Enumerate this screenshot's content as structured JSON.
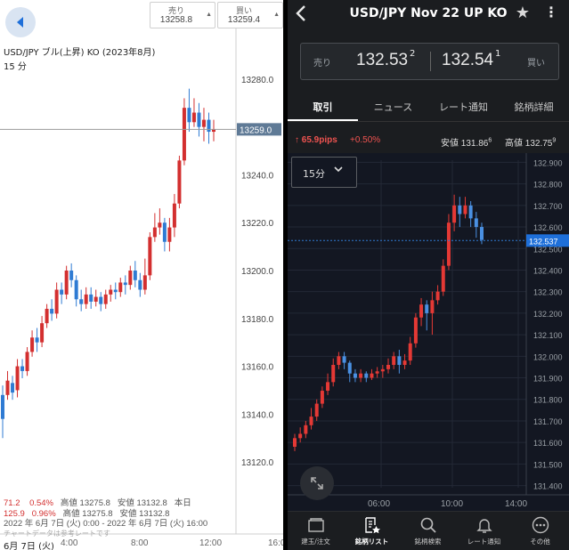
{
  "left": {
    "sell_quote": {
      "label": "売り",
      "value": "13258.8",
      "arrow": "▲"
    },
    "buy_quote": {
      "label": "買い",
      "value": "13259.4",
      "arrow": "▲"
    },
    "title": "USD/JPY ブル(上昇) KO (2023年8月)",
    "period": "15 分",
    "current_price": "13259.0",
    "stats": {
      "line1": {
        "change": "71.2",
        "pct": "0.54%",
        "high": "高値 13275.8",
        "low": "安値 13132.8",
        "note": "本日"
      },
      "line2": {
        "change": "125.9",
        "pct": "0.96%",
        "high": "高値 13275.8",
        "low": "安値 13132.8"
      },
      "range": "2022 年 6月 7日 (火) 0:00 - 2022 年 6月 7日 (火) 16:00"
    },
    "note": "チャートデータは参考レートです",
    "x_date_label": "6月 7日 (火)",
    "x_ticks": [
      "4:00",
      "8:00",
      "12:00",
      "16:0"
    ]
  },
  "right": {
    "title": "USD/JPY Nov 22 UP KO",
    "back_icon": "chevron-left-icon",
    "star_icon": "star-icon",
    "menu_icon": "more-vert-icon",
    "quote": {
      "sell_label": "売り",
      "sell_value": "132.53",
      "sell_sup": "2",
      "buy_value": "132.54",
      "buy_sup": "1",
      "buy_label": "買い"
    },
    "tabs": [
      "取引",
      "ニュース",
      "レート通知",
      "銘柄詳細"
    ],
    "stats": {
      "pips": "↑ 65.9pips",
      "pct": "+0.50%",
      "low_label": "安値",
      "low_value": "131.86",
      "low_sup": "6",
      "high_label": "高値",
      "high_value": "132.75",
      "high_sup": "9"
    },
    "period": "15分",
    "current_price": "132.537",
    "x_ticks": [
      "06:00",
      "10:00",
      "14:00"
    ],
    "nav": [
      {
        "label": "建玉/注文",
        "icon": "positions-icon"
      },
      {
        "label": "銘柄リスト",
        "icon": "watchlist-icon"
      },
      {
        "label": "銘柄検索",
        "icon": "search-icon"
      },
      {
        "label": "レート通知",
        "icon": "bell-icon"
      },
      {
        "label": "その他",
        "icon": "more-icon"
      }
    ],
    "active_nav": "銘柄リスト"
  },
  "colors": {
    "up": "#d32f2f",
    "down": "#2f7bd3",
    "right_up": "#e53935",
    "right_down": "#4a90e2",
    "accent": "#1e6fd9"
  },
  "chart_data": [
    {
      "type": "candlestick",
      "title": "USD/JPY ブル(上昇) KO (2023年8月)",
      "yticks": [
        13120.0,
        13140.0,
        13160.0,
        13180.0,
        13200.0,
        13220.0,
        13240.0,
        13260.0,
        13280.0
      ],
      "ylim": [
        13110,
        13290
      ],
      "xticks": [
        "4:00",
        "8:00",
        "12:00",
        "16:0"
      ],
      "current": 13259.0,
      "candles": [
        [
          13148,
          13138,
          13152,
          13130
        ],
        [
          13148,
          13154,
          13158,
          13146
        ],
        [
          13153,
          13149,
          13156,
          13146
        ],
        [
          13150,
          13160,
          13163,
          13147
        ],
        [
          13160,
          13158,
          13163,
          13155
        ],
        [
          13158,
          13166,
          13168,
          13156
        ],
        [
          13166,
          13172,
          13175,
          13164
        ],
        [
          13172,
          13170,
          13176,
          13166
        ],
        [
          13170,
          13178,
          13181,
          13168
        ],
        [
          13178,
          13184,
          13186,
          13176
        ],
        [
          13184,
          13182,
          13188,
          13179
        ],
        [
          13182,
          13192,
          13195,
          13180
        ],
        [
          13192,
          13190,
          13195,
          13186
        ],
        [
          13190,
          13200,
          13202,
          13188
        ],
        [
          13200,
          13196,
          13203,
          13193
        ],
        [
          13196,
          13188,
          13198,
          13185
        ],
        [
          13188,
          13186,
          13192,
          13183
        ],
        [
          13186,
          13190,
          13193,
          13184
        ],
        [
          13190,
          13187,
          13193,
          13184
        ],
        [
          13187,
          13189,
          13192,
          13185
        ],
        [
          13189,
          13186,
          13191,
          13183
        ],
        [
          13186,
          13190,
          13192,
          13184
        ],
        [
          13190,
          13192,
          13194,
          13187
        ],
        [
          13192,
          13191,
          13195,
          13188
        ],
        [
          13191,
          13195,
          13197,
          13189
        ],
        [
          13195,
          13194,
          13198,
          13190
        ],
        [
          13194,
          13200,
          13202,
          13192
        ],
        [
          13200,
          13196,
          13204,
          13193
        ],
        [
          13196,
          13192,
          13199,
          13189
        ],
        [
          13192,
          13198,
          13205,
          13190
        ],
        [
          13198,
          13214,
          13216,
          13196
        ],
        [
          13214,
          13218,
          13224,
          13212
        ],
        [
          13218,
          13220,
          13226,
          13215
        ],
        [
          13220,
          13212,
          13222,
          13208
        ],
        [
          13212,
          13218,
          13222,
          13208
        ],
        [
          13218,
          13228,
          13232,
          13214
        ],
        [
          13228,
          13246,
          13248,
          13226
        ],
        [
          13246,
          13268,
          13272,
          13244
        ],
        [
          13268,
          13262,
          13276,
          13258
        ],
        [
          13262,
          13266,
          13272,
          13260
        ],
        [
          13266,
          13260,
          13270,
          13256
        ],
        [
          13260,
          13263,
          13268,
          13254
        ],
        [
          13263,
          13258,
          13266,
          13253
        ],
        [
          13258,
          13259,
          13263,
          13254
        ]
      ]
    },
    {
      "type": "candlestick",
      "title": "USD/JPY Nov 22 UP KO",
      "yticks": [
        131.4,
        131.5,
        131.6,
        131.7,
        131.8,
        131.9,
        132.0,
        132.1,
        132.2,
        132.3,
        132.4,
        132.5,
        132.6,
        132.7,
        132.8,
        132.9
      ],
      "ylim": [
        131.39,
        132.91
      ],
      "xticks": [
        "06:00",
        "10:00",
        "14:00"
      ],
      "current": 132.537,
      "candles": [
        [
          131.58,
          131.62,
          131.64,
          131.56
        ],
        [
          131.62,
          131.64,
          131.67,
          131.6
        ],
        [
          131.64,
          131.68,
          131.7,
          131.62
        ],
        [
          131.68,
          131.72,
          131.76,
          131.66
        ],
        [
          131.72,
          131.78,
          131.8,
          131.7
        ],
        [
          131.78,
          131.84,
          131.86,
          131.76
        ],
        [
          131.84,
          131.88,
          131.92,
          131.82
        ],
        [
          131.88,
          131.96,
          131.99,
          131.86
        ],
        [
          131.96,
          132.0,
          132.02,
          131.94
        ],
        [
          132.0,
          131.97,
          132.02,
          131.94
        ],
        [
          131.97,
          131.92,
          131.98,
          131.88
        ],
        [
          131.92,
          131.9,
          131.94,
          131.88
        ],
        [
          131.9,
          131.92,
          131.94,
          131.88
        ],
        [
          131.92,
          131.9,
          131.93,
          131.88
        ],
        [
          131.9,
          131.92,
          131.94,
          131.89
        ],
        [
          131.92,
          131.93,
          131.95,
          131.9
        ],
        [
          131.93,
          131.94,
          131.96,
          131.9
        ],
        [
          131.94,
          131.96,
          131.99,
          131.92
        ],
        [
          131.96,
          132.0,
          132.02,
          131.94
        ],
        [
          132.0,
          131.96,
          132.03,
          131.92
        ],
        [
          131.96,
          131.98,
          132.01,
          131.94
        ],
        [
          131.98,
          132.06,
          132.09,
          131.96
        ],
        [
          132.06,
          132.18,
          132.2,
          132.04
        ],
        [
          132.18,
          132.24,
          132.27,
          132.14
        ],
        [
          132.24,
          132.2,
          132.26,
          132.12
        ],
        [
          132.2,
          132.26,
          132.3,
          132.1
        ],
        [
          132.26,
          132.3,
          132.33,
          132.24
        ],
        [
          132.3,
          132.42,
          132.45,
          132.28
        ],
        [
          132.42,
          132.62,
          132.66,
          132.4
        ],
        [
          132.62,
          132.7,
          132.75,
          132.58
        ],
        [
          132.7,
          132.66,
          132.74,
          132.6
        ],
        [
          132.66,
          132.7,
          132.74,
          132.64
        ],
        [
          132.7,
          132.64,
          132.72,
          132.6
        ],
        [
          132.64,
          132.6,
          132.67,
          132.55
        ],
        [
          132.6,
          132.54,
          132.62,
          132.52
        ]
      ]
    }
  ]
}
